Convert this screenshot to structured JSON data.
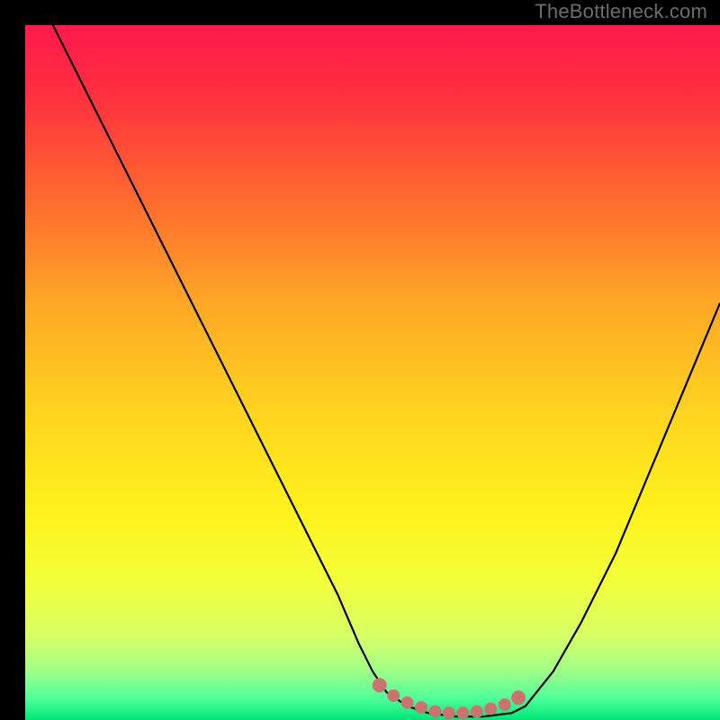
{
  "watermark": "TheBottleneck.com",
  "colors": {
    "background_black": "#000000",
    "curve_stroke": "#000000",
    "marker_fill": "#cc7370",
    "gradient_stops": [
      {
        "offset": 0.0,
        "color": "#ff1a4d"
      },
      {
        "offset": 0.1,
        "color": "#ff2f3f"
      },
      {
        "offset": 0.25,
        "color": "#ff6a2f"
      },
      {
        "offset": 0.4,
        "color": "#ffa726"
      },
      {
        "offset": 0.55,
        "color": "#ffd21f"
      },
      {
        "offset": 0.7,
        "color": "#fff21c"
      },
      {
        "offset": 0.8,
        "color": "#f3ff3a"
      },
      {
        "offset": 0.88,
        "color": "#d6ff66"
      },
      {
        "offset": 0.93,
        "color": "#9fff88"
      },
      {
        "offset": 0.97,
        "color": "#4cff9a"
      },
      {
        "offset": 1.0,
        "color": "#00e676"
      }
    ]
  },
  "chart_data": {
    "type": "line",
    "title": "",
    "xlabel": "",
    "ylabel": "",
    "xlim": [
      0,
      100
    ],
    "ylim": [
      0,
      100
    ],
    "series": [
      {
        "name": "bottleneck-curve",
        "x": [
          4,
          10,
          15,
          20,
          25,
          30,
          35,
          40,
          45,
          48,
          50,
          52,
          55,
          58,
          62,
          66,
          70,
          72,
          76,
          80,
          85,
          90,
          95,
          100
        ],
        "y": [
          100,
          88,
          78,
          68,
          58,
          48,
          38,
          28,
          18,
          11,
          7,
          4,
          2,
          1,
          0.5,
          0.5,
          1,
          2,
          7,
          14,
          24,
          36,
          48,
          60
        ]
      }
    ],
    "markers": {
      "name": "highlight-band",
      "x": [
        51,
        53,
        55,
        57,
        59,
        61,
        63,
        65,
        67,
        69,
        71
      ],
      "y": [
        5,
        3.5,
        2.5,
        1.8,
        1.2,
        1.0,
        1.0,
        1.2,
        1.6,
        2.2,
        3.2
      ]
    }
  }
}
